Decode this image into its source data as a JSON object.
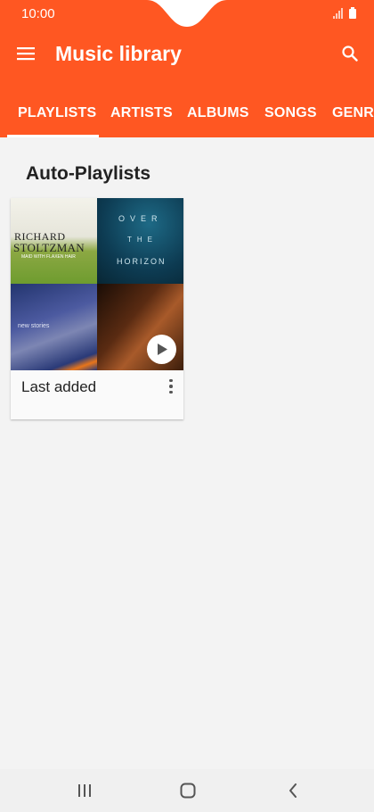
{
  "status_bar": {
    "time": "10:00"
  },
  "app_bar": {
    "title": "Music library"
  },
  "tabs": [
    {
      "label": "PLAYLISTS",
      "active": true
    },
    {
      "label": "ARTISTS"
    },
    {
      "label": "ALBUMS"
    },
    {
      "label": "SONGS"
    },
    {
      "label": "GENRES"
    }
  ],
  "section": {
    "title": "Auto-Playlists"
  },
  "playlist_card": {
    "title": "Last added",
    "album_art": [
      {
        "line1": "RICHARD",
        "line2": "STOLTZMAN",
        "line3": "MAID WITH FLAXEN HAIR"
      },
      {
        "line1": "OVER",
        "line2": "THE",
        "line3": "HORIZON"
      },
      {
        "line1": "new stories"
      },
      {
        "line1": ""
      }
    ]
  },
  "colors": {
    "accent": "#ff5722",
    "background": "#f3f3f3"
  },
  "icons": [
    "menu-icon",
    "search-icon",
    "play-icon",
    "more-vert-icon",
    "recents-icon",
    "home-icon",
    "back-icon",
    "signal-icon",
    "battery-icon"
  ]
}
